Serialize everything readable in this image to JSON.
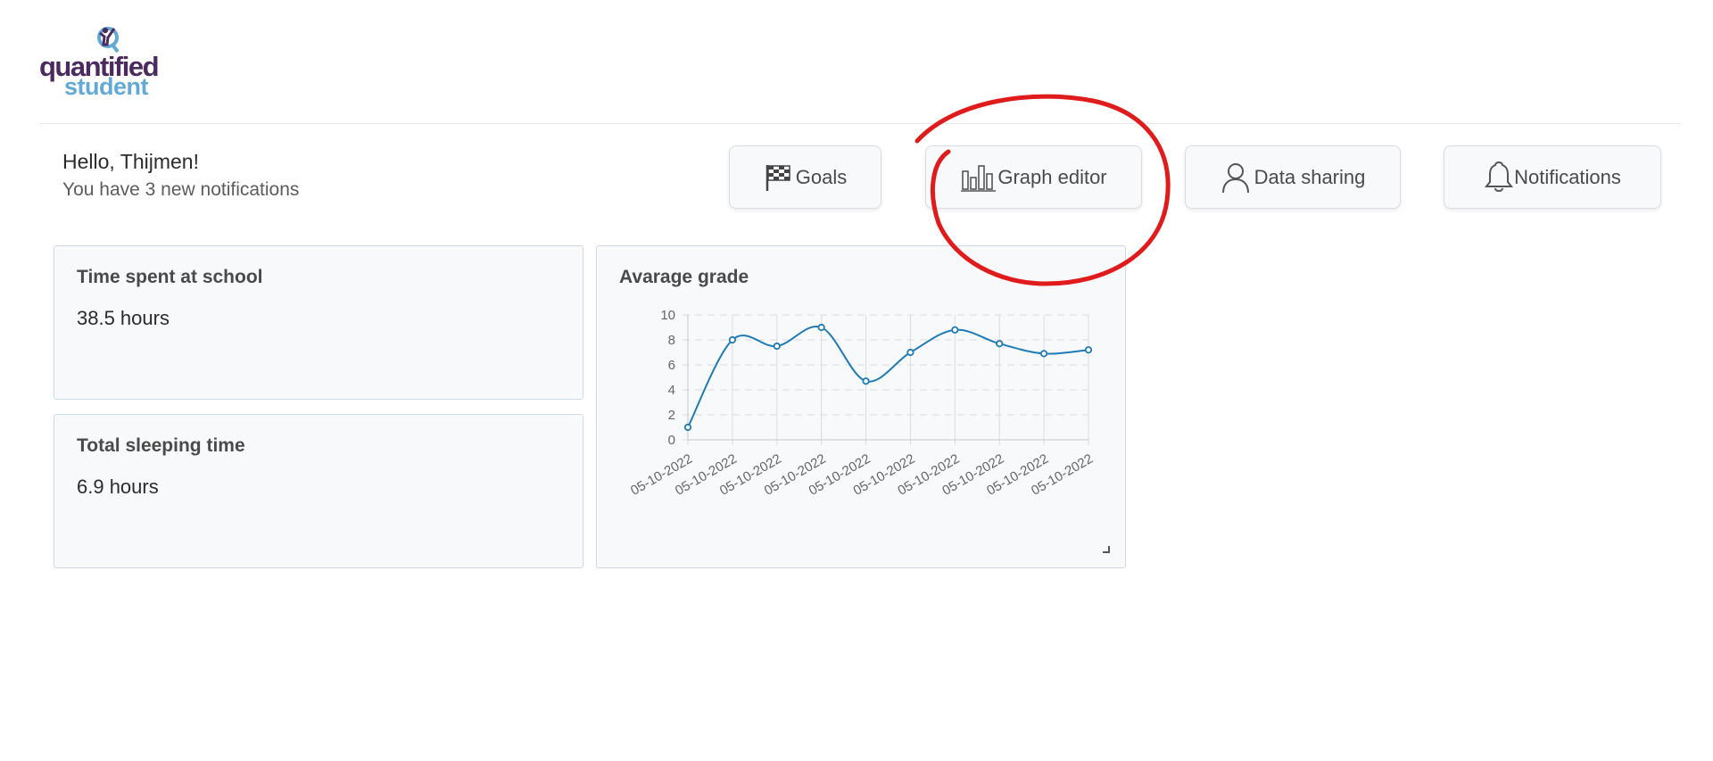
{
  "app": {
    "logo_top": "quantified",
    "logo_bottom": "student"
  },
  "greeting": {
    "hello": "Hello, Thijmen!",
    "subtitle": "You have 3 new notifications"
  },
  "nav": {
    "goals": {
      "label": "Goals",
      "icon": "checkered-flag-icon"
    },
    "graph_editor": {
      "label": "Graph editor",
      "icon": "bar-chart-icon"
    },
    "data_sharing": {
      "label": "Data sharing",
      "icon": "person-icon"
    },
    "notifications": {
      "label": "Notifications",
      "icon": "bell-icon"
    }
  },
  "cards": {
    "school": {
      "title": "Time spent at school",
      "value": "38.5 hours"
    },
    "sleep": {
      "title": "Total sleeping time",
      "value": "6.9 hours"
    },
    "grade": {
      "title": "Avarage grade"
    }
  },
  "colors": {
    "brand_purple": "#4b2a5f",
    "brand_blue": "#63a9d6",
    "line": "#1f7bb5",
    "annotation": "#e01b1b"
  },
  "chart_data": {
    "type": "line",
    "title": "Avarage grade",
    "x": [
      "05-10-2022",
      "05-10-2022",
      "05-10-2022",
      "05-10-2022",
      "05-10-2022",
      "05-10-2022",
      "05-10-2022",
      "05-10-2022",
      "05-10-2022",
      "05-10-2022"
    ],
    "series": [
      {
        "values": [
          1,
          8,
          7.5,
          9,
          4.7,
          7,
          8.8,
          7.7,
          6.9,
          7.2
        ]
      }
    ],
    "ylim": [
      0,
      10
    ],
    "yticks": [
      0,
      2,
      4,
      6,
      8,
      10
    ],
    "grid": true,
    "smooth": true
  }
}
